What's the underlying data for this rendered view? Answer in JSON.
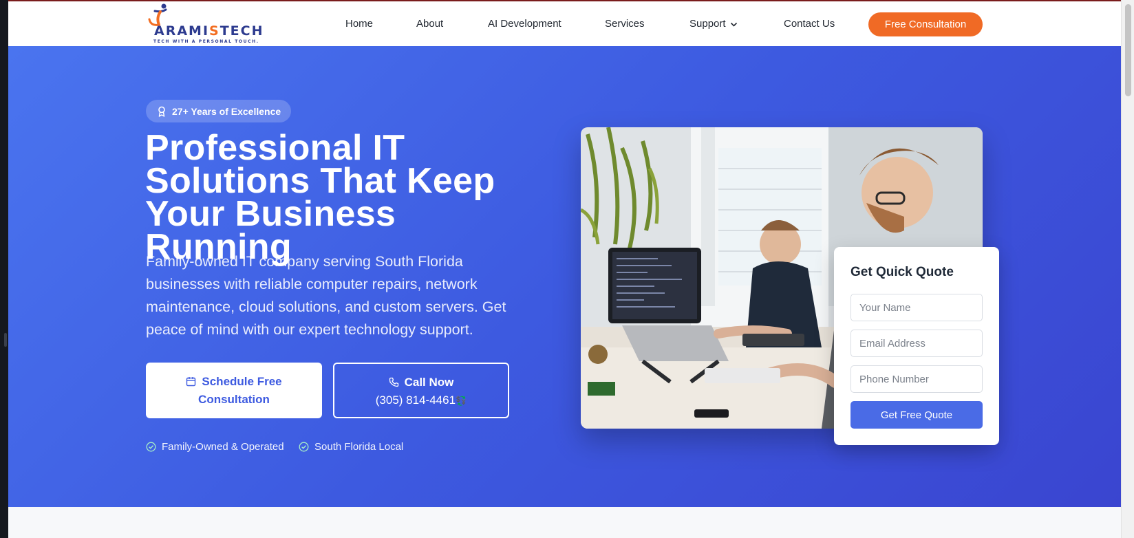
{
  "header": {
    "logo_text_main": "ARAMI",
    "logo_text_accent": "S",
    "logo_text_end": "TECH",
    "logo_tagline": "TECH WITH A PERSONAL TOUCH.",
    "nav": [
      {
        "label": "Home"
      },
      {
        "label": "About"
      },
      {
        "label": "AI Development"
      },
      {
        "label": "Services"
      },
      {
        "label": "Support"
      },
      {
        "label": "Contact Us"
      }
    ],
    "cta_label": "Free Consultation"
  },
  "hero": {
    "badge": "27+ Years of Excellence",
    "title_line1": "Professional IT",
    "title_line2": "Solutions That Keep",
    "title_line3": "Your Business Running",
    "subtitle": "Family-owned IT company serving South Florida businesses with reliable computer repairs, network maintenance, cloud solutions, and custom servers. Get peace of mind with our expert technology support.",
    "btn_schedule_line1": "Schedule Free",
    "btn_schedule_line2": "Consultation",
    "btn_call_line1": "Call Now",
    "btn_call_phone": "(305) 814-4461",
    "btn_call_emoji": "💱",
    "trust": [
      "Family-Owned & Operated",
      "South Florida Local"
    ]
  },
  "quote_form": {
    "title": "Get Quick Quote",
    "name_placeholder": "Your Name",
    "email_placeholder": "Email Address",
    "phone_placeholder": "Phone Number",
    "submit_label": "Get Free Quote"
  },
  "colors": {
    "brand_orange": "#f06a25",
    "hero_blue": "#3d5ae0",
    "logo_navy": "#2d3b8f"
  },
  "icons": [
    "award-icon",
    "calendar-icon",
    "phone-icon",
    "check-circle-icon",
    "chevron-down-icon"
  ]
}
